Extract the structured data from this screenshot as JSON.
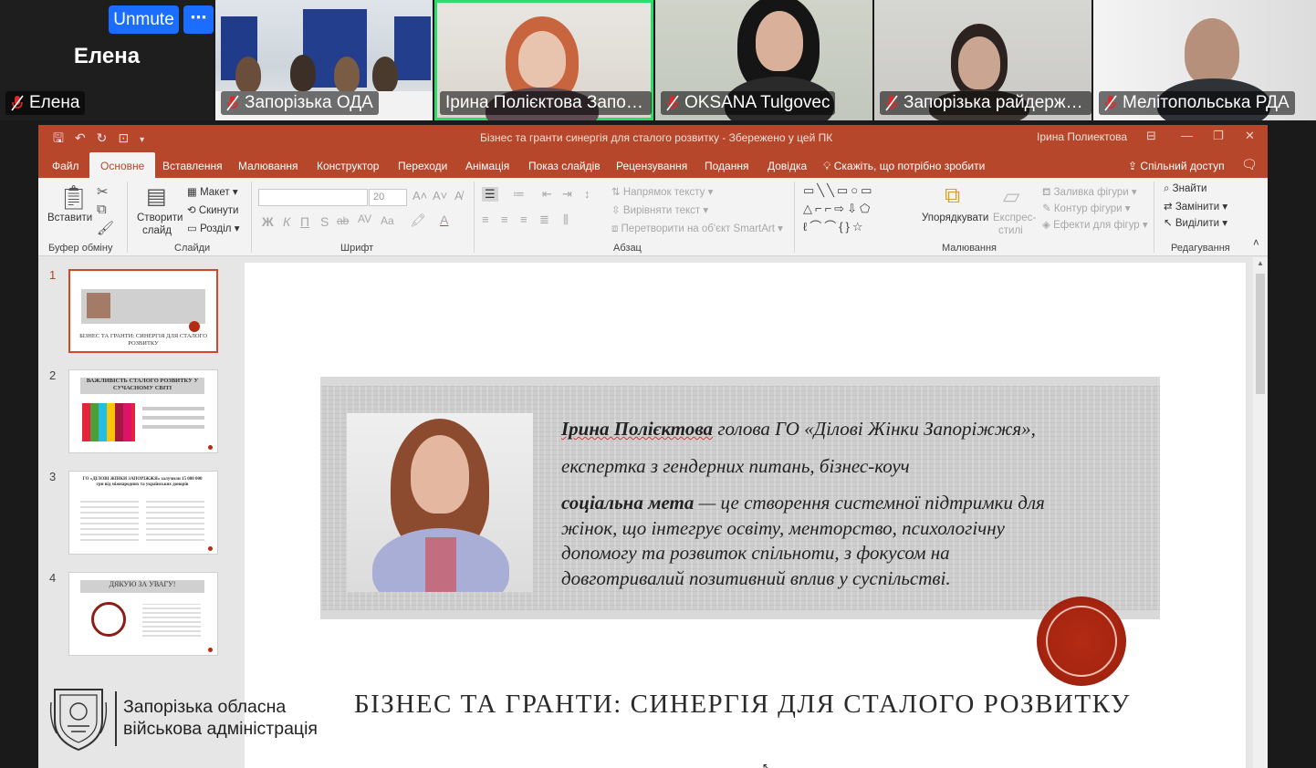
{
  "meeting": {
    "unmute_label": "Unmute",
    "more_label": "⋯",
    "self_big_name": "Елена",
    "participants": [
      {
        "name": "Елена"
      },
      {
        "name": "Запорізька ОДА"
      },
      {
        "name": "Ірина Полієктова Запорі..."
      },
      {
        "name": "OKSANA Tulgovec"
      },
      {
        "name": "Запорізька райдержа..."
      },
      {
        "name": "Мелітопольська РДА"
      }
    ]
  },
  "app": {
    "title": "Бізнес та гранти синергія для сталого розвитку  -  Збережено у цей ПК",
    "user": "Ірина Полиектова",
    "tabs": [
      "Файл",
      "Основне",
      "Вставлення",
      "Малювання",
      "Конструктор",
      "Переходи",
      "Анімація",
      "Показ слайдів",
      "Рецензування",
      "Подання",
      "Довідка"
    ],
    "tell_me": "Скажіть, що потрібно зробити",
    "share": "Спільний доступ"
  },
  "ribbon": {
    "clipboard": {
      "paste": "Вставити",
      "label": "Буфер обміну"
    },
    "slides": {
      "new_slide_1": "Створити",
      "new_slide_2": "слайд",
      "layout": "Макет",
      "reset": "Скинути",
      "section": "Розділ",
      "label": "Слайди"
    },
    "font": {
      "size": "20",
      "label": "Шрифт"
    },
    "paragraph": {
      "text_direction": "Напрямок тексту",
      "align_text": "Вирівняти текст",
      "smartart": "Перетворити на об'єкт SmartArt",
      "label": "Абзац"
    },
    "drawing": {
      "arrange": "Упорядкувати",
      "quick_styles_1": "Експрес-",
      "quick_styles_2": "стилі",
      "fill": "Заливка фігури",
      "outline": "Контур фігури",
      "effects": "Ефекти для фігур",
      "label": "Малювання"
    },
    "editing": {
      "find": "Знайти",
      "replace": "Замінити",
      "select": "Виділити",
      "label": "Редагування"
    }
  },
  "thumbnails": [
    {
      "num": "1",
      "caption": "БІЗНЕС ТА ГРАНТИ: СИНЕРГІЯ ДЛЯ СТАЛОГО РОЗВИТКУ"
    },
    {
      "num": "2",
      "caption": "ВАЖЛИВІСТЬ СТАЛОГО РОЗВИТКУ У СУЧАСНОМУ СВІТІ"
    },
    {
      "num": "3",
      "caption": "ГО «ДІЛОВІ ЖІНКИ ЗАПОРІЖЖЯ» залучили 15 000 000 грн від міжнародних та українських донорів"
    },
    {
      "num": "4",
      "caption": "ДЯКУЮ ЗА УВАГУ!"
    }
  ],
  "slide": {
    "name_bold": "Ірина Полієктова",
    "line1_rest": " голова ГО «Ділові Жінки Запоріжжя»,",
    "line2": "експертка з гендерних питань, бізнес-коуч",
    "mission_bold": "соціальна мета",
    "mission_rest": " — це створення системної підтримки для",
    "line4": "жінок, що інтегрує освіту, менторство, психологічну",
    "line5": "допомогу та розвиток спільноти, з фокусом на",
    "line6": "довготривалий позитивний вплив у суспільстві.",
    "title": "БІЗНЕС ТА ГРАНТИ: СИНЕРГІЯ ДЛЯ СТАЛОГО РОЗВИТКУ"
  },
  "org": {
    "line1": "Запорізька обласна",
    "line2": "військова адміністрація"
  },
  "colors": {
    "ppt_accent": "#b7472a",
    "zoom_blue": "#1a6dff",
    "active_speaker": "#2ddc6b"
  }
}
